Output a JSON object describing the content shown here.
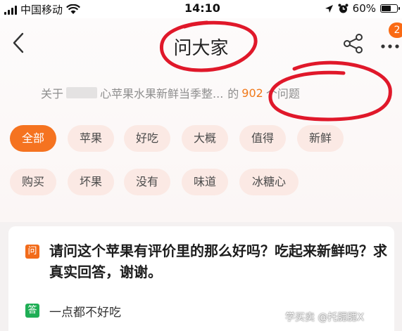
{
  "status_bar": {
    "carrier": "中国移动",
    "time": "14:10",
    "battery": "60%",
    "battery_level": 0.6
  },
  "nav": {
    "title": "问大家",
    "badge": "2"
  },
  "summary": {
    "prefix": "关于",
    "product": "心苹果水果新鲜当季整...",
    "mid": "的",
    "count": "902",
    "suffix": "个问题"
  },
  "tags": [
    {
      "label": "全部",
      "active": true
    },
    {
      "label": "苹果"
    },
    {
      "label": "好吃"
    },
    {
      "label": "大概"
    },
    {
      "label": "值得"
    },
    {
      "label": "新鲜"
    },
    {
      "label": "购买"
    },
    {
      "label": "坏果"
    },
    {
      "label": "没有"
    },
    {
      "label": "味道"
    },
    {
      "label": "冰糖心"
    }
  ],
  "question": {
    "mark": "问",
    "text": "请问这个苹果有评价里的那么好吗？吃起来新鲜吗？求真实回答，谢谢。"
  },
  "answer": {
    "mark": "答",
    "text": "一点都不好吃"
  },
  "watermark": "学买卖 @托腮腮X",
  "colors": {
    "accent": "#f57320",
    "annotation": "#e0182a",
    "answer_green": "#1fae55"
  }
}
